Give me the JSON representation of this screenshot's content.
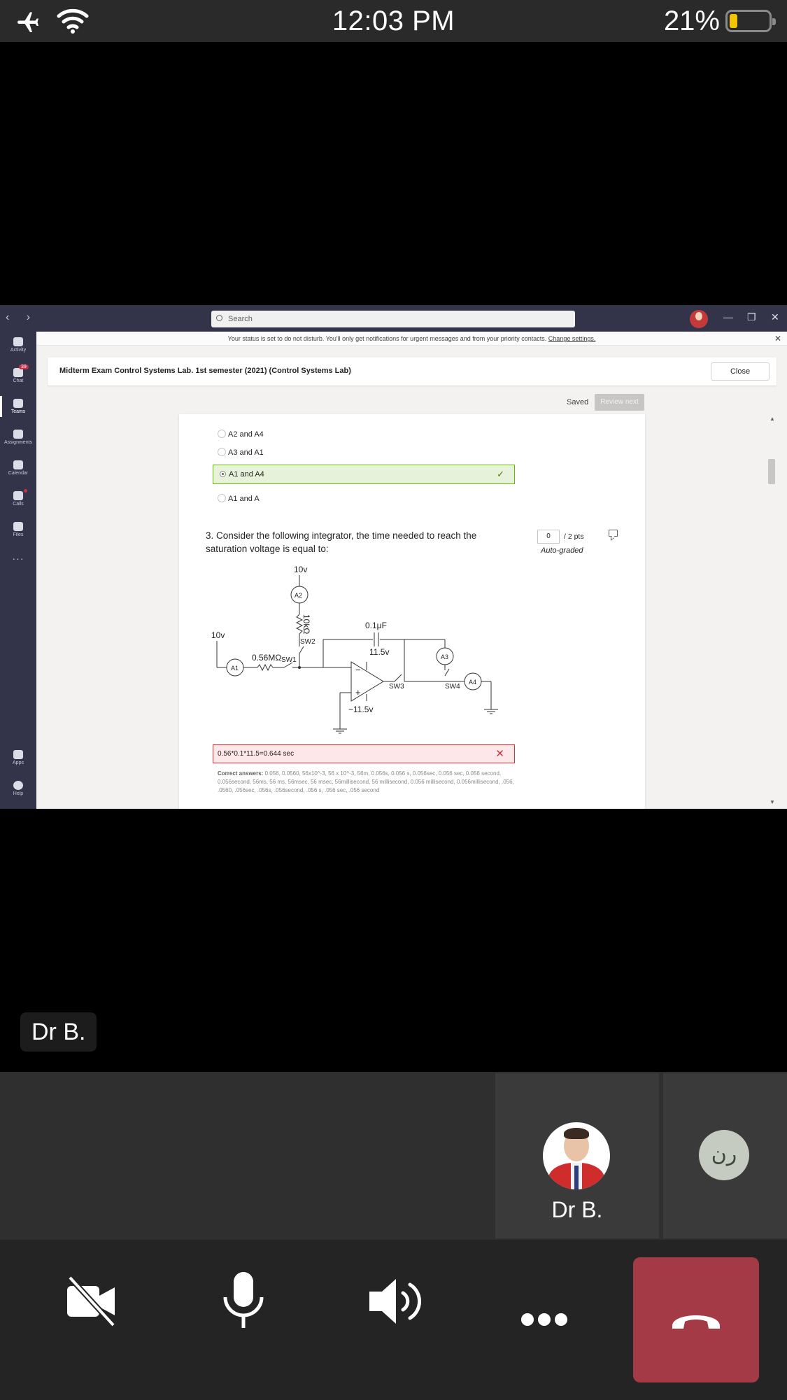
{
  "status_bar": {
    "time": "12:03 PM",
    "battery_percent": "21%",
    "battery_level": 0.21,
    "airplane_icon": "airplane-icon",
    "wifi_icon": "wifi-icon"
  },
  "teams": {
    "search": {
      "placeholder": "Search"
    },
    "dnd_notice": {
      "text": "Your status is set to do not disturb. You'll only get notifications for urgent messages and from your priority contacts.",
      "link": "Change settings."
    },
    "rail": [
      {
        "label": "Activity",
        "icon": "bell-icon"
      },
      {
        "label": "Chat",
        "icon": "chat-icon",
        "badge": "39"
      },
      {
        "label": "Teams",
        "icon": "teams-icon",
        "active": true
      },
      {
        "label": "Assignments",
        "icon": "assignments-icon"
      },
      {
        "label": "Calendar",
        "icon": "calendar-icon"
      },
      {
        "label": "Calls",
        "icon": "phone-icon"
      },
      {
        "label": "Files",
        "icon": "files-icon"
      },
      {
        "label": "Apps",
        "icon": "apps-icon"
      },
      {
        "label": "Help",
        "icon": "help-icon"
      }
    ],
    "exam": {
      "title": "Midterm Exam Control Systems Lab. 1st semester (2021) (Control Systems Lab)",
      "close_label": "Close",
      "saved_label": "Saved",
      "review_next_label": "Review next",
      "prev_options": [
        {
          "label": "A2 and A4"
        },
        {
          "label": "A3 and A1"
        },
        {
          "label": "A1 and A4",
          "correct": true
        },
        {
          "label": "A1 and A"
        }
      ],
      "question": {
        "number": "3.",
        "text": "Consider the following integrator, the time needed to reach the saturation voltage is equal to:",
        "score": "0",
        "points": "/ 2 pts",
        "grading": "Auto-graded"
      },
      "circuit_labels": {
        "v_top": "10v",
        "a2": "A2",
        "r_top": "10kΩ",
        "v_left": "10v",
        "cap": "0.1μF",
        "sw2": "SW2",
        "r_in": "0.56MΩ",
        "sw1": "SW1",
        "a1": "A1",
        "v_pos": "11.5v",
        "a3": "A3",
        "minus": "−",
        "plus": "+",
        "sw3": "SW3",
        "sw4": "SW4",
        "a4": "A4",
        "v_neg": "−11.5v"
      },
      "answer": {
        "text": "0.56*0.1*11.5=0.644 sec",
        "correct_label": "Correct answers:",
        "correct_list": "0.056, 0.0560, 56x10^-3, 56 x 10^-3, 56m, 0.056s, 0.056 s, 0.056sec, 0.056 sec, 0.056 second, 0.056second, 56ms, 56 ms, 56msec, 56 msec, 56millisecond, 56 millisecond, 0.056 millisecond, 0.056millisecond, .056, .0560, .056sec, .056s, .056second, .056 s, .056 sec, .056 second"
      }
    }
  },
  "call": {
    "speaker_name": "Dr B.",
    "participants": [
      {
        "name": "Dr B."
      },
      {
        "initials": "ر‌ن"
      }
    ],
    "controls": {
      "camera_icon": "camera-off-icon",
      "mic_icon": "microphone-icon",
      "speaker_icon": "speaker-icon",
      "more_icon": "more-icon",
      "hangup_icon": "hang-up-icon"
    }
  }
}
